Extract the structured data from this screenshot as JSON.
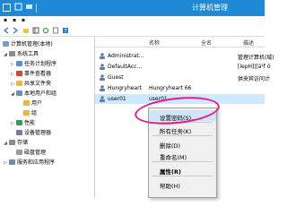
{
  "window": {
    "title": "计算机管理"
  },
  "tree": {
    "root": "计算机管理(本地)",
    "items": [
      {
        "label": "系统工具",
        "icon": "tools-icon"
      },
      {
        "label": "任务计划程序",
        "icon": "clock-icon"
      },
      {
        "label": "事件查看器",
        "icon": "event-viewer-icon"
      },
      {
        "label": "共享文件夹",
        "icon": "folder-icon"
      },
      {
        "label": "本地用户和组",
        "icon": "users-icon"
      },
      {
        "label": "用户",
        "icon": "folder-icon"
      },
      {
        "label": "组",
        "icon": "folder-icon"
      },
      {
        "label": "性能",
        "icon": "performance-icon"
      },
      {
        "label": "设备管理器",
        "icon": "device-manager-icon"
      },
      {
        "label": "存储",
        "icon": "storage-icon"
      },
      {
        "label": "磁盘管理",
        "icon": "disk-icon"
      },
      {
        "label": "服务和应用程序",
        "icon": "services-icon"
      }
    ]
  },
  "list": {
    "columns": [
      "名称",
      "全名",
      "描述"
    ],
    "rows": [
      {
        "name": "Administrat...",
        "fullname": "",
        "desc": "管理计算机(域)"
      },
      {
        "name": "DefaultAcc...",
        "fullname": "",
        "desc": "[lepH]|[ä¹f ö"
      },
      {
        "name": "Guest",
        "fullname": "",
        "desc": "供来宾访问计"
      },
      {
        "name": "Hungryheart",
        "fullname": "Hungryheart 66",
        "desc": ""
      },
      {
        "name": "user01",
        "fullname": "user01",
        "desc": ""
      }
    ]
  },
  "context_menu": {
    "items": [
      "设置密码(S)...",
      "所有任务(K)",
      "删除(D)",
      "重命名(M)",
      "属性(R)",
      "帮助(H)"
    ]
  },
  "colors": {
    "titlebar": "#1f89d6",
    "highlight_ring": "#e8178a",
    "selection": "#cde8ff"
  }
}
